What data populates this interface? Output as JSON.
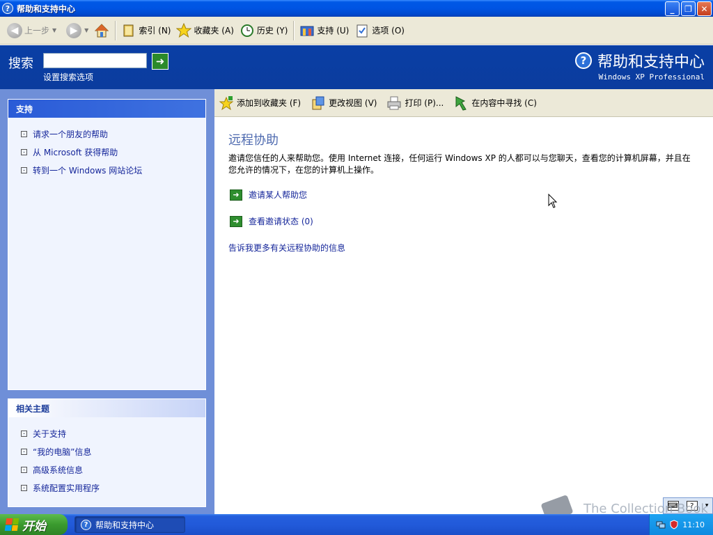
{
  "window": {
    "title": "帮助和支持中心",
    "controls": {
      "minimize": "_",
      "restore": "❐",
      "close": "✕"
    }
  },
  "toolbar": {
    "back_label": "上一步",
    "index_label": "索引 (N)",
    "favorites_label": "收藏夹 (A)",
    "history_label": "历史 (Y)",
    "support_label": "支持 (U)",
    "options_label": "选项 (O)"
  },
  "search": {
    "label": "搜索",
    "value": "",
    "options_link": "设置搜索选项",
    "go_glyph": "➜"
  },
  "header": {
    "title": "帮助和支持中心",
    "subtitle": "Windows XP Professional"
  },
  "sidebar": {
    "support": {
      "title": "支持",
      "items": [
        {
          "label": "请求一个朋友的帮助"
        },
        {
          "label": "从 Microsoft 获得帮助"
        },
        {
          "label": "转到一个 Windows 网站论坛"
        }
      ]
    },
    "related": {
      "title": "相关主题",
      "items": [
        {
          "label": "关于支持"
        },
        {
          "label": "“我的电脑”信息"
        },
        {
          "label": "高级系统信息"
        },
        {
          "label": "系统配置实用程序"
        }
      ]
    }
  },
  "content_toolbar": {
    "add_favorites_label": "添加到收藏夹 (F)",
    "change_view_label": "更改视图 (V)",
    "print_label": "打印 (P)...",
    "locate_label": "在内容中寻找 (C)"
  },
  "content": {
    "title": "远程协助",
    "description": "邀请您信任的人来帮助您。使用 Internet 连接，任何运行 Windows XP 的人都可以与您聊天，查看您的计算机屏幕，并且在您允许的情况下，在您的计算机上操作。",
    "actions": [
      {
        "label": "邀请某人帮助您"
      },
      {
        "label": "查看邀请状态 (0)"
      }
    ],
    "more_info": "告诉我更多有关远程协助的信息"
  },
  "taskbar": {
    "start_label": "开始",
    "task_label": "帮助和支持中心",
    "clock": "11:10"
  },
  "watermark": "The Collection Book",
  "colors": {
    "titlebar": "#0054e3",
    "header_blue": "#0b3c9e",
    "sidebar_blue": "#6f8fd8",
    "link": "#15269a",
    "content_title": "#4f6bb0",
    "start_green": "#3a9a2e"
  }
}
